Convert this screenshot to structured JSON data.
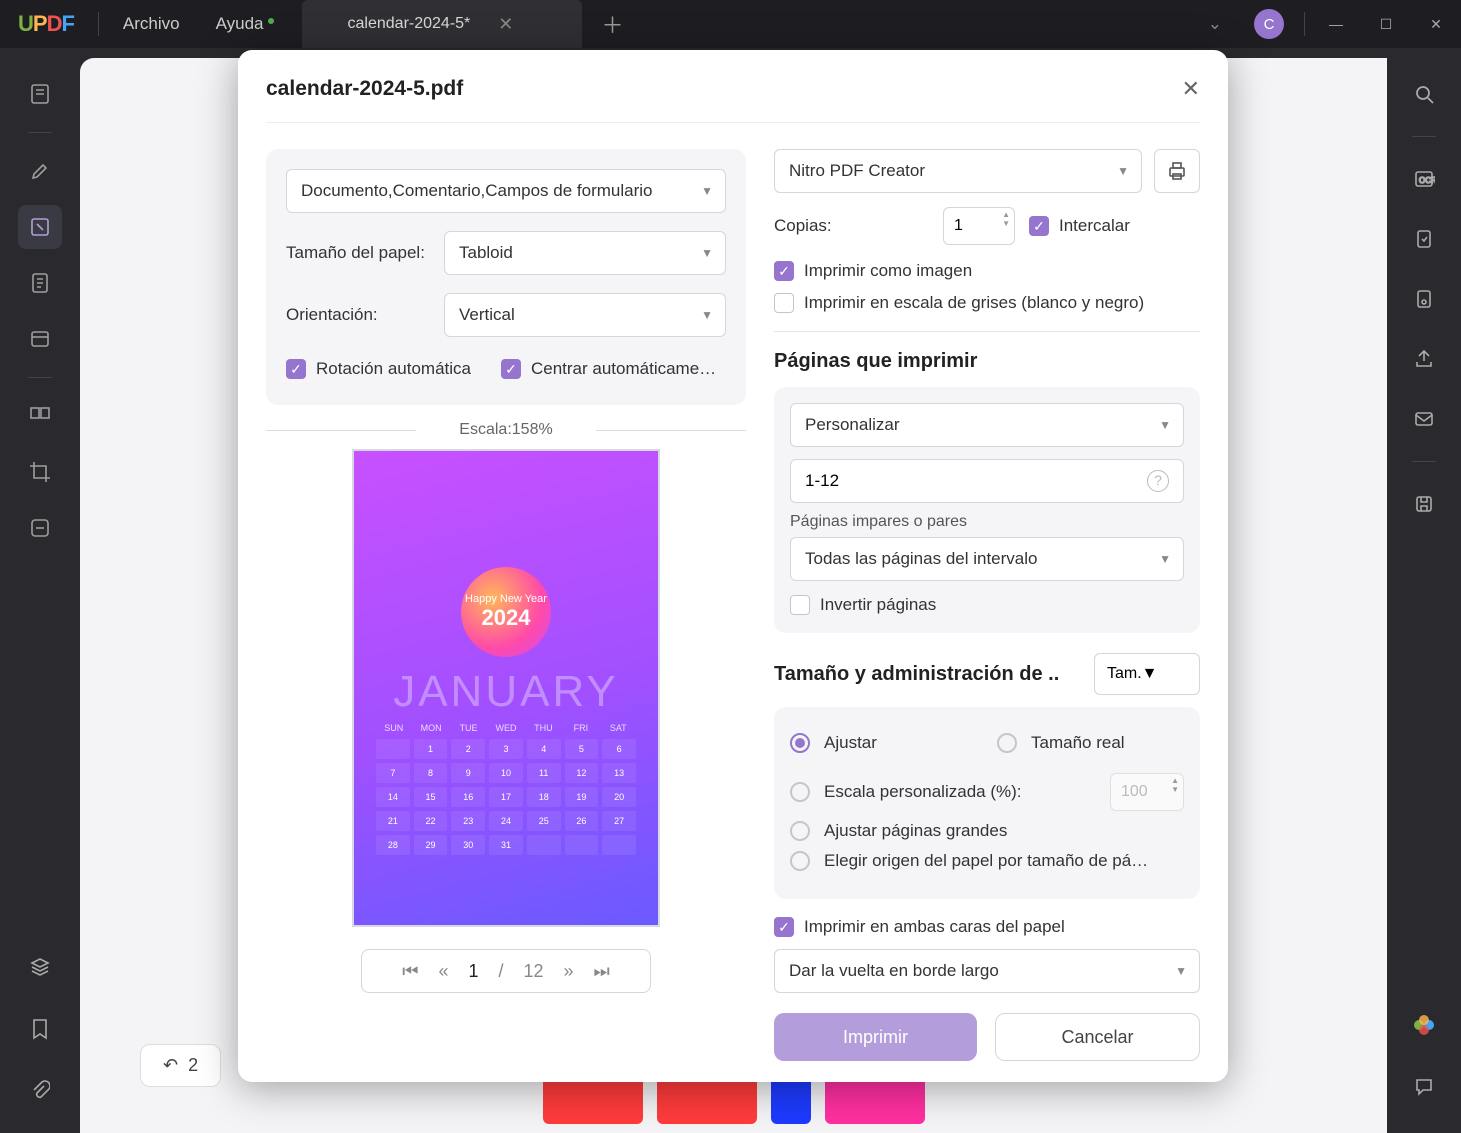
{
  "menu": {
    "archivo": "Archivo",
    "ayuda": "Ayuda"
  },
  "tab": {
    "title": "calendar-2024-5*"
  },
  "avatar": "C",
  "undo_count": "2",
  "modal": {
    "title": "calendar-2024-5.pdf",
    "left": {
      "content_select": "Documento,Comentario,Campos de formulario",
      "paper_size_label": "Tamaño del papel:",
      "paper_size": "Tabloid",
      "orientation_label": "Orientación:",
      "orientation": "Vertical",
      "auto_rotate": "Rotación automática",
      "auto_center": "Centrar automáticame…",
      "scale": "Escala:158%",
      "preview_month": "JANUARY",
      "preview_badge_top": "Happy New Year",
      "preview_year": "2024",
      "pager_current": "1",
      "pager_sep": "/",
      "pager_total": "12"
    },
    "right": {
      "printer": "Nitro PDF Creator",
      "copies_label": "Copias:",
      "copies": "1",
      "collate": "Intercalar",
      "print_as_image": "Imprimir como imagen",
      "grayscale": "Imprimir en escala de grises (blanco y negro)",
      "pages_title": "Páginas que imprimir",
      "pages_mode": "Personalizar",
      "pages_range": "1-12",
      "odd_even_label": "Páginas impares o pares",
      "odd_even": "Todas las páginas del intervalo",
      "invert": "Invertir páginas",
      "size_title": "Tamaño y administración de ..",
      "size_mode": "Tam.",
      "fit": "Ajustar",
      "actual": "Tamaño real",
      "custom_scale": "Escala personalizada (%):",
      "custom_scale_val": "100",
      "fit_large": "Ajustar páginas grandes",
      "paper_source": "Elegir origen del papel por tamaño de pá…",
      "duplex": "Imprimir en ambas caras del papel",
      "flip": "Dar la vuelta en borde largo",
      "print": "Imprimir",
      "cancel": "Cancelar"
    }
  }
}
